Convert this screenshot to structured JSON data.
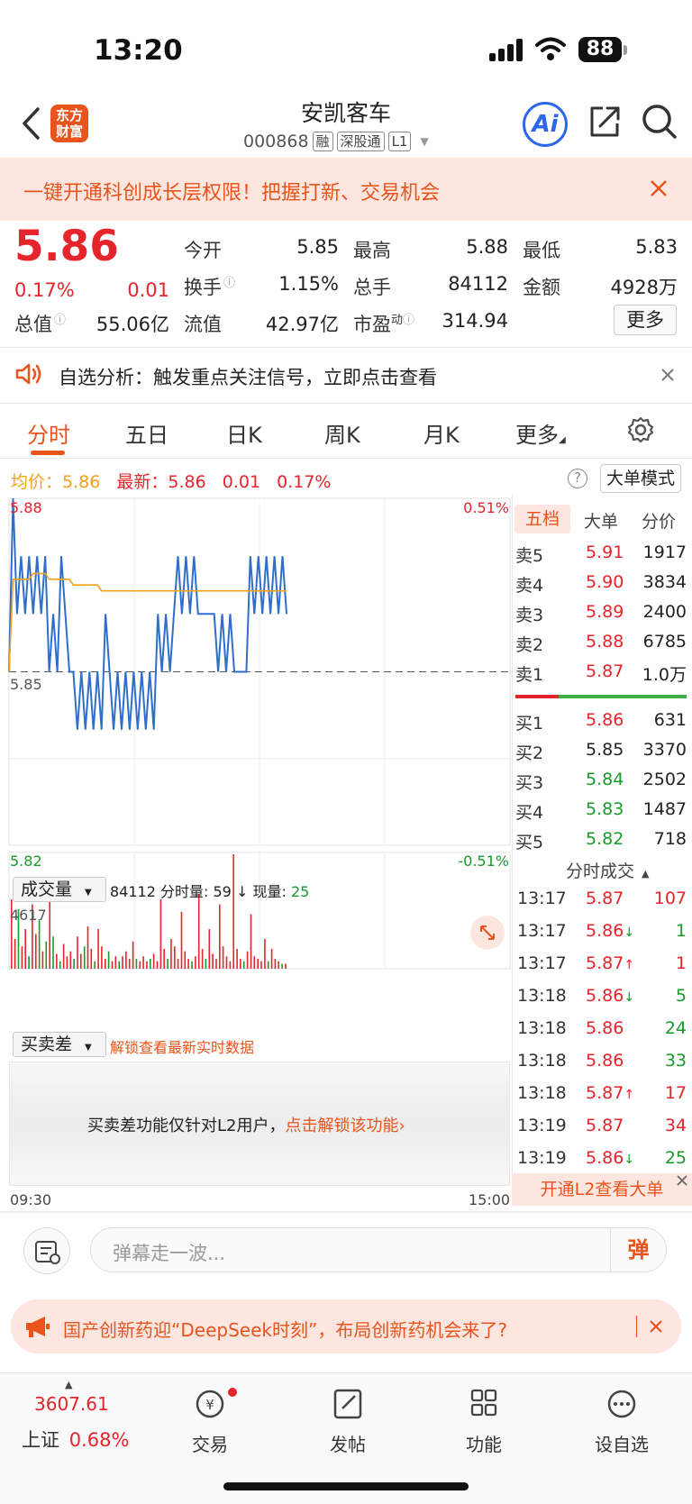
{
  "status_bar": {
    "time": "13:20",
    "battery": "88"
  },
  "header": {
    "logo_text": "东方财富",
    "stock_name": "安凯客车",
    "stock_code": "000868",
    "tags": [
      "融",
      "深股通",
      "L1"
    ],
    "ai_label": "Ai"
  },
  "promo_banner": {
    "text": "一键开通科创成长层权限！把握打新、交易机会"
  },
  "quote": {
    "price": "5.86",
    "change_pct": "0.17%",
    "change": "0.01",
    "fields": [
      {
        "label": "今开",
        "value": "5.85",
        "color": "#222222"
      },
      {
        "label": "最高",
        "value": "5.88",
        "color": "#e6242b"
      },
      {
        "label": "最低",
        "value": "5.83",
        "color": "#1a9a2a"
      },
      {
        "label": "换手",
        "value": "1.15%",
        "color": "#222222"
      },
      {
        "label": "总手",
        "value": "84112",
        "color": "#222222"
      },
      {
        "label": "金额",
        "value": "4928万",
        "color": "#222222"
      },
      {
        "label": "总值",
        "value": "55.06亿",
        "color": "#222222"
      },
      {
        "label": "流值",
        "value": "42.97亿",
        "color": "#222222"
      },
      {
        "label": "市盈",
        "value": "314.94",
        "color": "#222222"
      }
    ],
    "pe_superscript": "动",
    "more_label": "更多"
  },
  "notice": {
    "text": "自选分析：触发重点关注信号，立即点击查看"
  },
  "tabs": [
    "分时",
    "五日",
    "日K",
    "周K",
    "月K",
    "更多"
  ],
  "chart_header": {
    "avg_label": "均价：",
    "avg_value": "5.86",
    "latest_label": "最新：",
    "latest_value": "5.86",
    "latest_change": "0.01",
    "latest_pct": "0.17%",
    "big_order_label": "大单模式"
  },
  "chart_data": {
    "type": "line",
    "title": "",
    "y_max_label": "5.88",
    "y_mid_label": "5.85",
    "y_min_label": "5.82",
    "pct_max_label": "0.51%",
    "pct_min_label": "-0.51%",
    "x_start_label": "09:30",
    "x_end_label": "15:00",
    "ylim": [
      5.82,
      5.88
    ],
    "prev_close": 5.85,
    "series": [
      {
        "values": [
          5.85,
          5.88,
          5.86,
          5.87,
          5.86,
          5.87,
          5.86,
          5.87,
          5.86,
          5.87,
          5.85,
          5.86,
          5.85,
          5.87,
          5.86,
          5.85,
          5.85,
          5.84,
          5.85,
          5.84,
          5.85,
          5.84,
          5.85,
          5.84,
          5.86,
          5.85,
          5.84,
          5.85,
          5.84,
          5.85,
          5.84,
          5.85,
          5.84,
          5.85,
          5.84,
          5.85,
          5.84,
          5.86,
          5.85,
          5.86,
          5.85,
          5.86,
          5.87,
          5.86,
          5.87,
          5.86,
          5.87,
          5.86,
          5.86,
          5.86,
          5.86,
          5.86,
          5.85,
          5.86,
          5.85,
          5.86,
          5.85,
          5.85,
          5.85,
          5.85,
          5.87,
          5.86,
          5.87,
          5.86,
          5.87,
          5.86,
          5.87,
          5.86,
          5.87,
          5.86
        ]
      },
      {
        "values": [
          5.85,
          5.866,
          5.866,
          5.866,
          5.866,
          5.866,
          5.867,
          5.867,
          5.867,
          5.867,
          5.866,
          5.866,
          5.866,
          5.866,
          5.866,
          5.866,
          5.865,
          5.865,
          5.865,
          5.865,
          5.865,
          5.865,
          5.865,
          5.864,
          5.864,
          5.864,
          5.864,
          5.864,
          5.864,
          5.864,
          5.864,
          5.864,
          5.864,
          5.864,
          5.864,
          5.864,
          5.864,
          5.864,
          5.864,
          5.864,
          5.864,
          5.864,
          5.864,
          5.864,
          5.864,
          5.864,
          5.864,
          5.864,
          5.864,
          5.864,
          5.864,
          5.864,
          5.864,
          5.864,
          5.864,
          5.864,
          5.864,
          5.864,
          5.864,
          5.864,
          5.864,
          5.864,
          5.864,
          5.864,
          5.864,
          5.864,
          5.864,
          5.864,
          5.864,
          5.864
        ]
      }
    ],
    "volume": {
      "selector_label": "成交量",
      "total": "84112",
      "minute_label": "分时量:",
      "minute_value": "59",
      "now_label": "现量:",
      "now_value": "25",
      "max_label": "4617",
      "ylim": [
        0,
        4617
      ],
      "values": [
        2800,
        1200,
        2400,
        900,
        1600,
        500,
        2600,
        1400,
        2000,
        700,
        1100,
        2700,
        1300,
        600,
        300,
        1000,
        500,
        700,
        400,
        1300,
        600,
        900,
        1700,
        800,
        300,
        1600,
        900,
        400,
        700,
        300,
        500,
        300,
        500,
        700,
        400,
        1100,
        400,
        300,
        500,
        300,
        400,
        600,
        300,
        2800,
        800,
        400,
        1200,
        900,
        400,
        2300,
        700,
        400,
        300,
        500,
        3000,
        800,
        400,
        1600,
        600,
        400,
        2600,
        900,
        500,
        300,
        4617,
        800,
        400,
        300,
        700,
        2200,
        500,
        400,
        300,
        1200,
        300,
        800,
        400,
        300,
        200,
        200
      ],
      "colors": [
        "r",
        "r",
        "g",
        "r",
        "r",
        "g",
        "r",
        "r",
        "g",
        "r",
        "g",
        "r",
        "g",
        "r",
        "g",
        "r",
        "r",
        "r",
        "g",
        "r",
        "r",
        "g",
        "r",
        "r",
        "g",
        "r",
        "r",
        "r",
        "g",
        "r",
        "r",
        "g",
        "r",
        "r",
        "r",
        "r",
        "g",
        "r",
        "r",
        "r",
        "g",
        "r",
        "r",
        "r",
        "r",
        "g",
        "r",
        "r",
        "r",
        "r",
        "r",
        "r",
        "g",
        "r",
        "r",
        "r",
        "g",
        "r",
        "r",
        "r",
        "r",
        "r",
        "r",
        "r",
        "r",
        "r",
        "r",
        "g",
        "r",
        "r",
        "r",
        "r",
        "r",
        "r",
        "g",
        "r",
        "r",
        "r",
        "g",
        "r"
      ]
    },
    "spread": {
      "selector_label": "买卖差",
      "unlock_hint": "解锁查看最新实时数据",
      "lock_text": "买卖差功能仅针对L2用户，",
      "lock_link": "点击解锁该功能›"
    }
  },
  "order_book": {
    "tabs": [
      "五档",
      "大单",
      "分价"
    ],
    "asks": [
      {
        "label": "卖5",
        "price": "5.91",
        "vol": "1917",
        "color": "#e6242b"
      },
      {
        "label": "卖4",
        "price": "5.90",
        "vol": "3834",
        "color": "#e6242b"
      },
      {
        "label": "卖3",
        "price": "5.89",
        "vol": "2400",
        "color": "#e6242b"
      },
      {
        "label": "卖2",
        "price": "5.88",
        "vol": "6785",
        "color": "#e6242b"
      },
      {
        "label": "卖1",
        "price": "5.87",
        "vol": "1.0万",
        "color": "#e6242b"
      }
    ],
    "bids": [
      {
        "label": "买1",
        "price": "5.86",
        "vol": "631",
        "color": "#e6242b"
      },
      {
        "label": "买2",
        "price": "5.85",
        "vol": "3370",
        "color": "#222222"
      },
      {
        "label": "买3",
        "price": "5.84",
        "vol": "2502",
        "color": "#1a9a2a"
      },
      {
        "label": "买4",
        "price": "5.83",
        "vol": "1487",
        "color": "#1a9a2a"
      },
      {
        "label": "买5",
        "price": "5.82",
        "vol": "718",
        "color": "#1a9a2a"
      }
    ]
  },
  "trades": {
    "title": "分时成交",
    "rows": [
      {
        "time": "13:17",
        "price": "5.87",
        "arrow": "",
        "vol": "107",
        "vol_color": "#e6242b"
      },
      {
        "time": "13:17",
        "price": "5.86",
        "arrow": "↓",
        "vol": "1",
        "vol_color": "#1a9a2a"
      },
      {
        "time": "13:17",
        "price": "5.87",
        "arrow": "↑",
        "vol": "1",
        "vol_color": "#e6242b"
      },
      {
        "time": "13:18",
        "price": "5.86",
        "arrow": "↓",
        "vol": "5",
        "vol_color": "#1a9a2a"
      },
      {
        "time": "13:18",
        "price": "5.86",
        "arrow": "",
        "vol": "24",
        "vol_color": "#1a9a2a"
      },
      {
        "time": "13:18",
        "price": "5.86",
        "arrow": "",
        "vol": "33",
        "vol_color": "#1a9a2a"
      },
      {
        "time": "13:18",
        "price": "5.87",
        "arrow": "↑",
        "vol": "17",
        "vol_color": "#e6242b"
      },
      {
        "time": "13:19",
        "price": "5.87",
        "arrow": "",
        "vol": "34",
        "vol_color": "#e6242b"
      },
      {
        "time": "13:19",
        "price": "5.86",
        "arrow": "↓",
        "vol": "25",
        "vol_color": "#1a9a2a"
      }
    ],
    "l2_banner": "开通L2查看大单"
  },
  "danmu": {
    "placeholder": "弹幕走一波...",
    "send_label": "弹"
  },
  "ad_banner": {
    "text": "国产创新药迎“DeepSeek时刻”，布局创新药机会来了?"
  },
  "tabbar": {
    "index_value": "3607.61",
    "index_name": "上证",
    "index_pct": "0.68%",
    "items": [
      "交易",
      "发帖",
      "功能",
      "设自选"
    ]
  }
}
